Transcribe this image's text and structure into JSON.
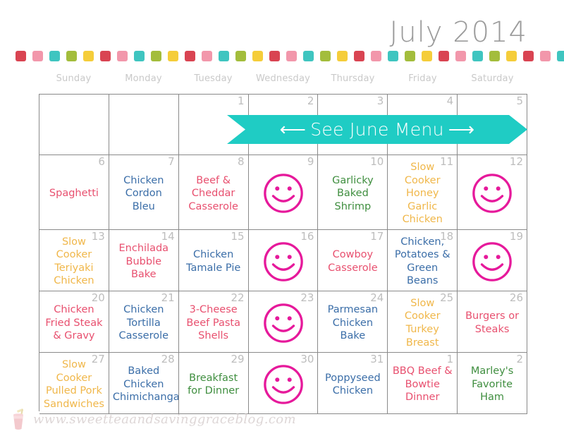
{
  "header": {
    "title": "July 2014"
  },
  "dots": {
    "colors": [
      "#d94452",
      "#f297ab",
      "#3fc5c0",
      "#a3bd3c",
      "#f5cd3a"
    ],
    "count": 41
  },
  "weekdays": [
    "Sunday",
    "Monday",
    "Tuesday",
    "Wednesday",
    "Thursday",
    "Friday",
    "Saturday"
  ],
  "banner": {
    "text": "See June Menu",
    "left_arrow": "⟵",
    "right_arrow": "⟶",
    "color": "#1fccc4"
  },
  "colors": {
    "red": "#e8506f",
    "blue": "#3b6ea8",
    "green": "#3f8e3f",
    "gold": "#f0b74a",
    "smiley": "#e6199b",
    "grid_line": "#8a8a8a",
    "daynum": "#bdbdbd",
    "weekday": "#c9c9c9",
    "title": "#9b9b9b"
  },
  "weeks": [
    {
      "cells": [
        {
          "day": "",
          "meal": "",
          "color": "",
          "icon": "",
          "banner": false
        },
        {
          "day": "",
          "meal": "",
          "color": "",
          "icon": "",
          "banner": false
        },
        {
          "day": "1",
          "meal": "",
          "color": "",
          "icon": "",
          "banner": true
        },
        {
          "day": "2",
          "meal": "",
          "color": "",
          "icon": "",
          "banner": true
        },
        {
          "day": "3",
          "meal": "",
          "color": "",
          "icon": "",
          "banner": true
        },
        {
          "day": "4",
          "meal": "",
          "color": "",
          "icon": "",
          "banner": true
        },
        {
          "day": "5",
          "meal": "",
          "color": "",
          "icon": "",
          "banner": true
        }
      ]
    },
    {
      "cells": [
        {
          "day": "6",
          "meal": "Spaghetti",
          "color": "c-red",
          "icon": ""
        },
        {
          "day": "7",
          "meal": "Chicken\nCordon\nBleu",
          "color": "c-blue",
          "icon": ""
        },
        {
          "day": "8",
          "meal": "Beef &\nCheddar\nCasserole",
          "color": "c-red",
          "icon": ""
        },
        {
          "day": "9",
          "meal": "",
          "color": "",
          "icon": "smiley-face-icon"
        },
        {
          "day": "10",
          "meal": "Garlicky\nBaked\nShrimp",
          "color": "c-green",
          "icon": ""
        },
        {
          "day": "11",
          "meal": "Slow Cooker\nHoney Garlic\nChicken",
          "color": "c-gold",
          "icon": ""
        },
        {
          "day": "12",
          "meal": "",
          "color": "",
          "icon": "smiley-face-icon"
        }
      ]
    },
    {
      "cells": [
        {
          "day": "13",
          "meal": "Slow\nCooker\nTeriyaki\nChicken",
          "color": "c-gold",
          "icon": ""
        },
        {
          "day": "14",
          "meal": "Enchilada\nBubble Bake",
          "color": "c-red",
          "icon": ""
        },
        {
          "day": "15",
          "meal": "Chicken\nTamale Pie",
          "color": "c-blue",
          "icon": ""
        },
        {
          "day": "16",
          "meal": "",
          "color": "",
          "icon": "smiley-face-icon"
        },
        {
          "day": "17",
          "meal": "Cowboy\nCasserole",
          "color": "c-red",
          "icon": ""
        },
        {
          "day": "18",
          "meal": "Chicken,\nPotatoes &\nGreen Beans",
          "color": "c-blue",
          "icon": ""
        },
        {
          "day": "19",
          "meal": "",
          "color": "",
          "icon": "smiley-face-icon"
        }
      ]
    },
    {
      "cells": [
        {
          "day": "20",
          "meal": "Chicken\nFried Steak\n& Gravy",
          "color": "c-red",
          "icon": ""
        },
        {
          "day": "21",
          "meal": "Chicken\nTortilla\nCasserole",
          "color": "c-blue",
          "icon": ""
        },
        {
          "day": "22",
          "meal": "3-Cheese\nBeef Pasta\nShells",
          "color": "c-red",
          "icon": ""
        },
        {
          "day": "23",
          "meal": "",
          "color": "",
          "icon": "smiley-face-icon"
        },
        {
          "day": "24",
          "meal": "Parmesan\nChicken\nBake",
          "color": "c-blue",
          "icon": ""
        },
        {
          "day": "25",
          "meal": "Slow Cooker\nTurkey Breast",
          "color": "c-gold",
          "icon": ""
        },
        {
          "day": "26",
          "meal": "Burgers or\nSteaks",
          "color": "c-red",
          "icon": ""
        }
      ]
    },
    {
      "cells": [
        {
          "day": "27",
          "meal": "Slow Cooker\nPulled Pork\nSandwiches",
          "color": "c-gold",
          "icon": ""
        },
        {
          "day": "28",
          "meal": "Baked\nChicken\nChimichangas",
          "color": "c-blue",
          "icon": ""
        },
        {
          "day": "29",
          "meal": "Breakfast\nfor Dinner",
          "color": "c-green",
          "icon": ""
        },
        {
          "day": "30",
          "meal": "",
          "color": "",
          "icon": "smiley-face-icon"
        },
        {
          "day": "31",
          "meal": "Poppyseed\nChicken",
          "color": "c-blue",
          "icon": ""
        },
        {
          "day": "1",
          "meal": "BBQ Beef &\nBowtie\nDinner",
          "color": "c-red",
          "icon": ""
        },
        {
          "day": "2",
          "meal": "Marley's\nFavorite\nHam",
          "color": "c-green",
          "icon": ""
        }
      ]
    }
  ],
  "footer": {
    "url": "www.sweetteaandsavinggraceblog.com",
    "icon": "drink-glass-icon"
  }
}
